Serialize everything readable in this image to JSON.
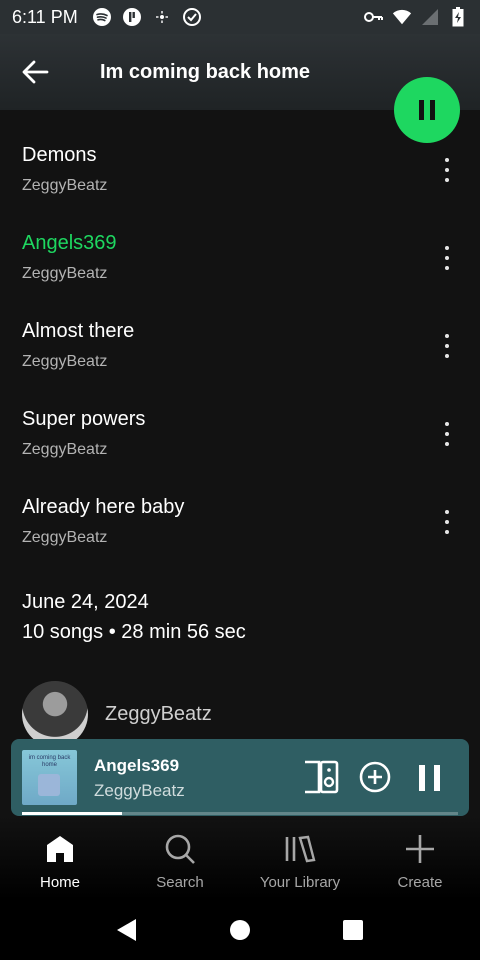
{
  "status_bar": {
    "time": "6:11 PM",
    "left_icons": [
      "spotify-icon",
      "app-icon",
      "settings-icon",
      "vpn-icon"
    ],
    "right_icons": [
      "key-icon",
      "wifi-icon",
      "signal-icon",
      "battery-icon"
    ]
  },
  "header": {
    "title": "Im coming back home"
  },
  "tracks": [
    {
      "title": "Demons",
      "artist": "ZeggyBeatz",
      "playing": false
    },
    {
      "title": "Angels369",
      "artist": "ZeggyBeatz",
      "playing": true
    },
    {
      "title": "Almost there",
      "artist": "ZeggyBeatz",
      "playing": false
    },
    {
      "title": "Super powers",
      "artist": "ZeggyBeatz",
      "playing": false
    },
    {
      "title": "Already here baby",
      "artist": "ZeggyBeatz",
      "playing": false
    }
  ],
  "album_info": {
    "release_date": "June 24, 2024",
    "meta": "10 songs • 28 min 56 sec"
  },
  "artist": {
    "name": "ZeggyBeatz"
  },
  "mini_player": {
    "title": "Angels369",
    "artist": "ZeggyBeatz",
    "art_text": "im coming back home",
    "progress": 0.23
  },
  "bottom_nav": [
    {
      "label": "Home",
      "icon": "home-icon",
      "active": true
    },
    {
      "label": "Search",
      "icon": "search-icon",
      "active": false
    },
    {
      "label": "Your Library",
      "icon": "library-icon",
      "active": false
    },
    {
      "label": "Create",
      "icon": "plus-icon",
      "active": false
    }
  ],
  "colors": {
    "accent": "#1ed760",
    "mini_player_bg": "#2f5e63",
    "background": "#121212"
  }
}
